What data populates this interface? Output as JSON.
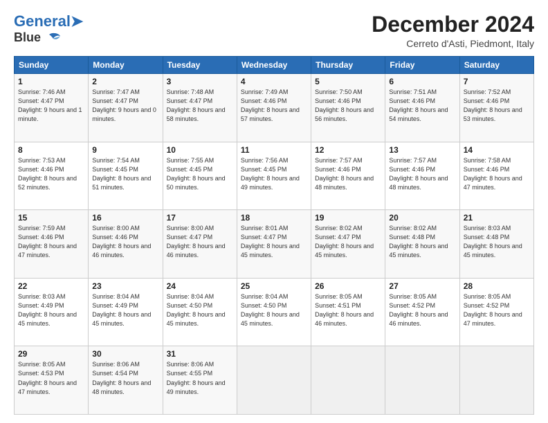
{
  "header": {
    "logo_line1": "General",
    "logo_line2": "Blue",
    "main_title": "December 2024",
    "sub_title": "Cerreto d'Asti, Piedmont, Italy"
  },
  "calendar": {
    "days_of_week": [
      "Sunday",
      "Monday",
      "Tuesday",
      "Wednesday",
      "Thursday",
      "Friday",
      "Saturday"
    ],
    "weeks": [
      [
        {
          "day": "1",
          "sunrise": "7:46 AM",
          "sunset": "4:47 PM",
          "daylight": "9 hours and 1 minute."
        },
        {
          "day": "2",
          "sunrise": "7:47 AM",
          "sunset": "4:47 PM",
          "daylight": "9 hours and 0 minutes."
        },
        {
          "day": "3",
          "sunrise": "7:48 AM",
          "sunset": "4:47 PM",
          "daylight": "8 hours and 58 minutes."
        },
        {
          "day": "4",
          "sunrise": "7:49 AM",
          "sunset": "4:46 PM",
          "daylight": "8 hours and 57 minutes."
        },
        {
          "day": "5",
          "sunrise": "7:50 AM",
          "sunset": "4:46 PM",
          "daylight": "8 hours and 56 minutes."
        },
        {
          "day": "6",
          "sunrise": "7:51 AM",
          "sunset": "4:46 PM",
          "daylight": "8 hours and 54 minutes."
        },
        {
          "day": "7",
          "sunrise": "7:52 AM",
          "sunset": "4:46 PM",
          "daylight": "8 hours and 53 minutes."
        }
      ],
      [
        {
          "day": "8",
          "sunrise": "7:53 AM",
          "sunset": "4:46 PM",
          "daylight": "8 hours and 52 minutes."
        },
        {
          "day": "9",
          "sunrise": "7:54 AM",
          "sunset": "4:45 PM",
          "daylight": "8 hours and 51 minutes."
        },
        {
          "day": "10",
          "sunrise": "7:55 AM",
          "sunset": "4:45 PM",
          "daylight": "8 hours and 50 minutes."
        },
        {
          "day": "11",
          "sunrise": "7:56 AM",
          "sunset": "4:45 PM",
          "daylight": "8 hours and 49 minutes."
        },
        {
          "day": "12",
          "sunrise": "7:57 AM",
          "sunset": "4:46 PM",
          "daylight": "8 hours and 48 minutes."
        },
        {
          "day": "13",
          "sunrise": "7:57 AM",
          "sunset": "4:46 PM",
          "daylight": "8 hours and 48 minutes."
        },
        {
          "day": "14",
          "sunrise": "7:58 AM",
          "sunset": "4:46 PM",
          "daylight": "8 hours and 47 minutes."
        }
      ],
      [
        {
          "day": "15",
          "sunrise": "7:59 AM",
          "sunset": "4:46 PM",
          "daylight": "8 hours and 47 minutes."
        },
        {
          "day": "16",
          "sunrise": "8:00 AM",
          "sunset": "4:46 PM",
          "daylight": "8 hours and 46 minutes."
        },
        {
          "day": "17",
          "sunrise": "8:00 AM",
          "sunset": "4:47 PM",
          "daylight": "8 hours and 46 minutes."
        },
        {
          "day": "18",
          "sunrise": "8:01 AM",
          "sunset": "4:47 PM",
          "daylight": "8 hours and 45 minutes."
        },
        {
          "day": "19",
          "sunrise": "8:02 AM",
          "sunset": "4:47 PM",
          "daylight": "8 hours and 45 minutes."
        },
        {
          "day": "20",
          "sunrise": "8:02 AM",
          "sunset": "4:48 PM",
          "daylight": "8 hours and 45 minutes."
        },
        {
          "day": "21",
          "sunrise": "8:03 AM",
          "sunset": "4:48 PM",
          "daylight": "8 hours and 45 minutes."
        }
      ],
      [
        {
          "day": "22",
          "sunrise": "8:03 AM",
          "sunset": "4:49 PM",
          "daylight": "8 hours and 45 minutes."
        },
        {
          "day": "23",
          "sunrise": "8:04 AM",
          "sunset": "4:49 PM",
          "daylight": "8 hours and 45 minutes."
        },
        {
          "day": "24",
          "sunrise": "8:04 AM",
          "sunset": "4:50 PM",
          "daylight": "8 hours and 45 minutes."
        },
        {
          "day": "25",
          "sunrise": "8:04 AM",
          "sunset": "4:50 PM",
          "daylight": "8 hours and 45 minutes."
        },
        {
          "day": "26",
          "sunrise": "8:05 AM",
          "sunset": "4:51 PM",
          "daylight": "8 hours and 46 minutes."
        },
        {
          "day": "27",
          "sunrise": "8:05 AM",
          "sunset": "4:52 PM",
          "daylight": "8 hours and 46 minutes."
        },
        {
          "day": "28",
          "sunrise": "8:05 AM",
          "sunset": "4:52 PM",
          "daylight": "8 hours and 47 minutes."
        }
      ],
      [
        {
          "day": "29",
          "sunrise": "8:05 AM",
          "sunset": "4:53 PM",
          "daylight": "8 hours and 47 minutes."
        },
        {
          "day": "30",
          "sunrise": "8:06 AM",
          "sunset": "4:54 PM",
          "daylight": "8 hours and 48 minutes."
        },
        {
          "day": "31",
          "sunrise": "8:06 AM",
          "sunset": "4:55 PM",
          "daylight": "8 hours and 49 minutes."
        },
        null,
        null,
        null,
        null
      ]
    ]
  }
}
